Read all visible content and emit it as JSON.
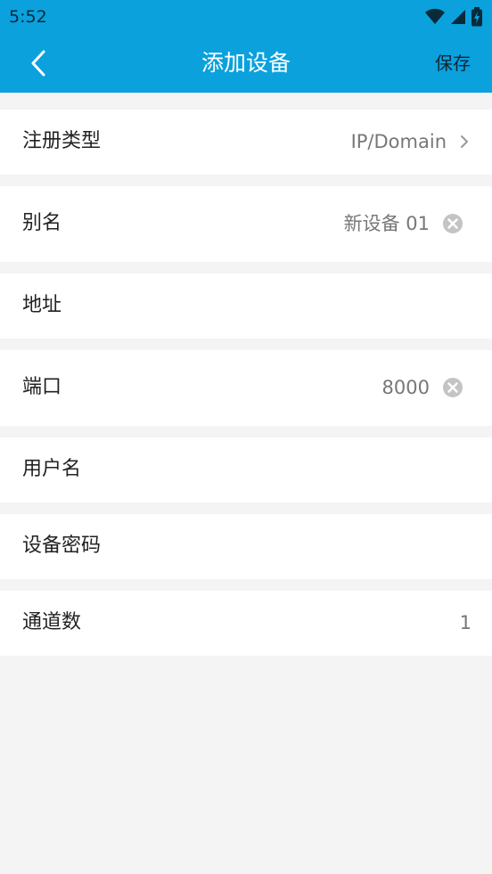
{
  "status": {
    "time": "5:52"
  },
  "appbar": {
    "title": "添加设备",
    "save_label": "保存"
  },
  "form": {
    "register_type": {
      "label": "注册类型",
      "value": "IP/Domain"
    },
    "alias": {
      "label": "别名",
      "value": "新设备 01"
    },
    "address": {
      "label": "地址",
      "value": ""
    },
    "port": {
      "label": "端口",
      "value": "8000"
    },
    "username": {
      "label": "用户名",
      "value": ""
    },
    "password": {
      "label": "设备密码",
      "value": ""
    },
    "channels": {
      "label": "通道数",
      "value": "1"
    }
  },
  "colors": {
    "accent": "#0aa1dd",
    "background": "#f4f4f4",
    "row": "#ffffff",
    "secondary_text": "#777777"
  },
  "icons": {
    "back": "chevron-left-icon",
    "wifi": "wifi-icon",
    "signal": "signal-icon",
    "battery": "battery-icon",
    "chevron": "chevron-right-icon",
    "clear": "clear-icon"
  }
}
